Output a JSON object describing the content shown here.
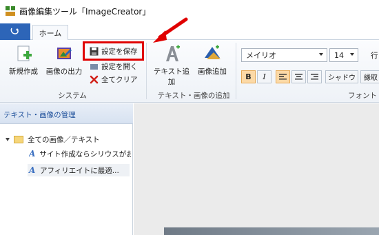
{
  "window": {
    "title": "画像編集ツール「ImageCreator」"
  },
  "tabs": {
    "app_menu_icon": "stethoscope-like-icon",
    "home": "ホーム"
  },
  "ribbon": {
    "system": {
      "new": "新規作成",
      "output": "画像の出力",
      "save_settings": "設定を保存",
      "open_settings": "設定を開く",
      "clear_all": "全てクリア",
      "group": "システム"
    },
    "add": {
      "add_text": "テキスト追加",
      "add_image": "画像追加",
      "group": "テキスト・画像の追加"
    },
    "font": {
      "family": "メイリオ",
      "size": "14",
      "line_label": "行",
      "bold": "B",
      "italic": "I",
      "shadow": "シャドウ",
      "border": "縁取",
      "group": "フォント"
    }
  },
  "panel": {
    "title": "テキスト・画像の管理",
    "root": "全ての画像／テキスト",
    "items": [
      "サイト作成ならシリウスがお️",
      "アフィリエイトに最適..."
    ]
  },
  "colors": {
    "accent": "#2d65b8",
    "highlight": "#e00000",
    "active": "#fcd9a6"
  }
}
